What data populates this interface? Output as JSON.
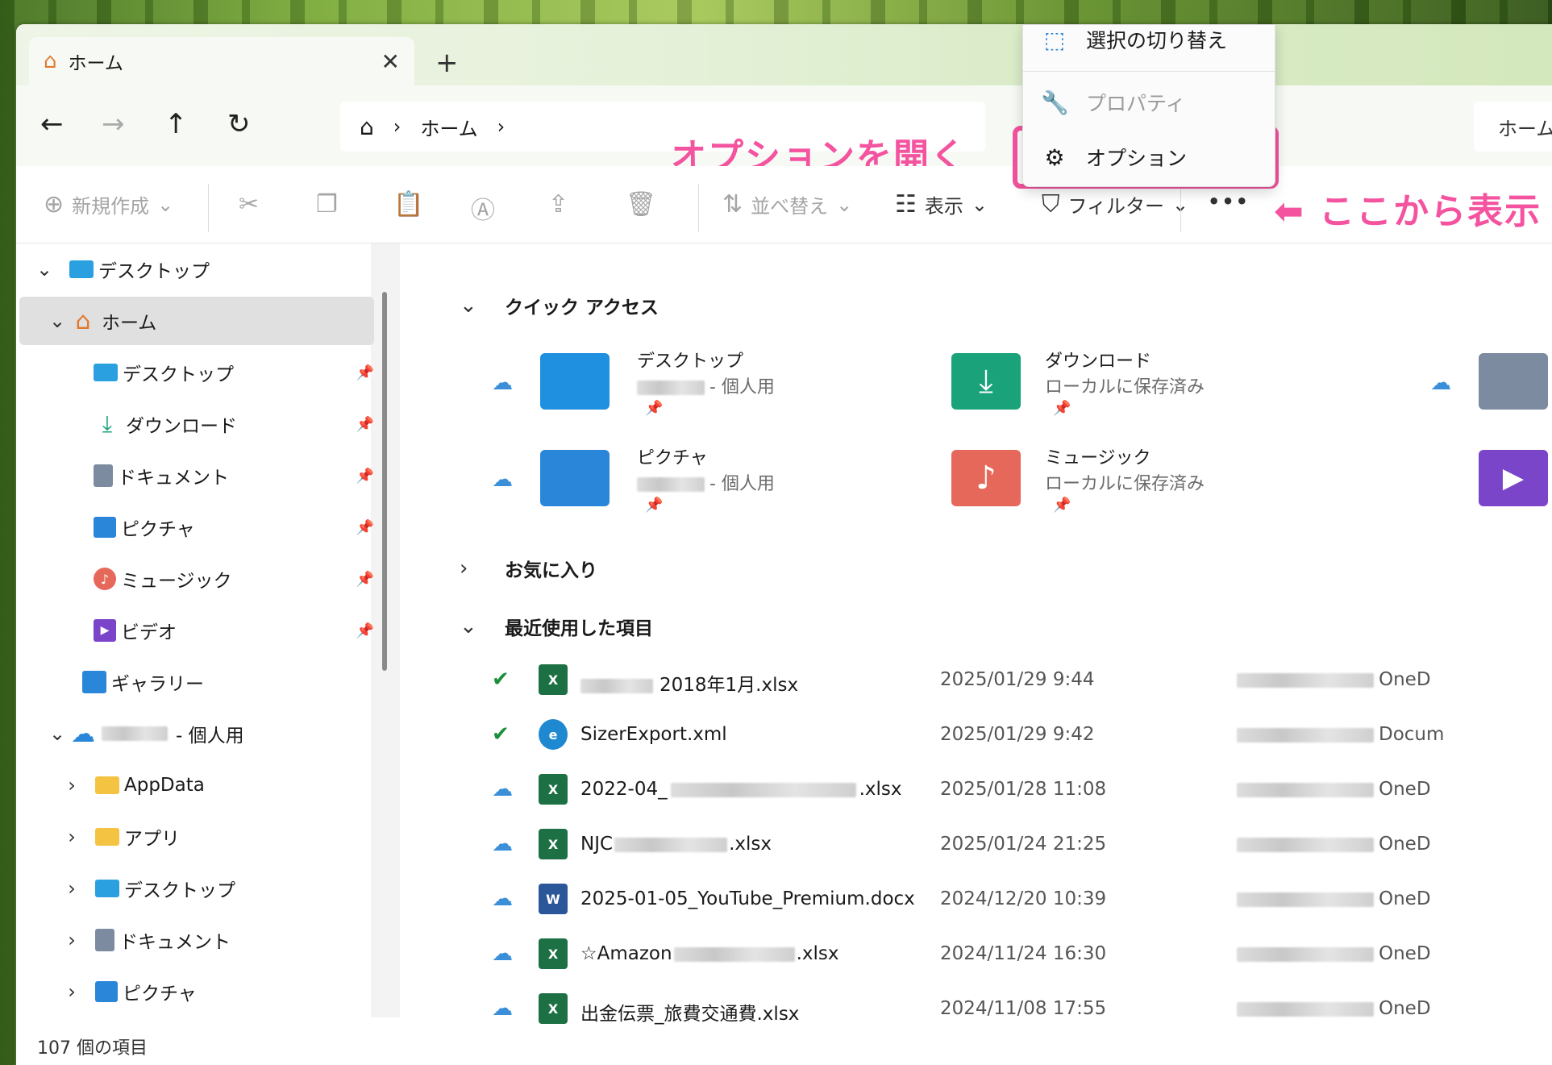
{
  "tab": {
    "title": "ホーム",
    "close": "✕",
    "new_tab": "+"
  },
  "nav": {
    "back": "←",
    "forward": "→",
    "up": "↑",
    "refresh": "↻"
  },
  "address": {
    "crumbs": [
      "ホーム"
    ],
    "sep": "›",
    "search_stub": "ホーム"
  },
  "annotations": {
    "open_options": "オプションを開く",
    "show_from_here": "⬅ ここから表示"
  },
  "menu": {
    "items": [
      {
        "label": "選択の切り替え",
        "icon": "select-toggle-icon"
      },
      {
        "label": "プロパティ",
        "icon": "wrench-icon"
      },
      {
        "label": "オプション",
        "icon": "gear-icon"
      }
    ]
  },
  "toolbar": {
    "new_label": "新規作成",
    "sort_label": "並べ替え",
    "view_label": "表示",
    "filter_label": "フィルター",
    "more_label": "•••",
    "chevron": "⌄"
  },
  "sidebar": {
    "items": [
      {
        "label": "デスクトップ",
        "icon": "desktop-icon",
        "pinned": false,
        "expanded": true
      },
      {
        "label": "ホーム",
        "icon": "home-icon",
        "pinned": false,
        "expanded": true,
        "selected": true
      },
      {
        "label": "デスクトップ",
        "icon": "desktop-icon",
        "pinned": true
      },
      {
        "label": "ダウンロード",
        "icon": "download-icon",
        "pinned": true
      },
      {
        "label": "ドキュメント",
        "icon": "document-icon",
        "pinned": true
      },
      {
        "label": "ピクチャ",
        "icon": "pictures-icon",
        "pinned": true
      },
      {
        "label": "ミュージック",
        "icon": "music-icon",
        "pinned": true
      },
      {
        "label": "ビデオ",
        "icon": "video-icon",
        "pinned": true
      },
      {
        "label": "ギャラリー",
        "icon": "gallery-icon",
        "pinned": false
      },
      {
        "label": "- 個人用",
        "icon": "onedrive-icon",
        "pinned": false,
        "expanded": true
      },
      {
        "label": "AppData",
        "icon": "folder-icon"
      },
      {
        "label": "アプリ",
        "icon": "folder-icon"
      },
      {
        "label": "デスクトップ",
        "icon": "desktop-icon"
      },
      {
        "label": "ドキュメント",
        "icon": "document-icon"
      },
      {
        "label": "ピクチャ",
        "icon": "pictures-icon"
      }
    ]
  },
  "sections": {
    "quick_access": "クイック アクセス",
    "favorites": "お気に入り",
    "recent": "最近使用した項目"
  },
  "quick_access": [
    {
      "name": "デスクトップ",
      "sub": "- 個人用",
      "icon": "desktop-folder-icon",
      "color": "#1f8fe0"
    },
    {
      "name": "ダウンロード",
      "sub": "ローカルに保存済み",
      "icon": "downloads-folder-icon",
      "color": "#1aa37a"
    },
    {
      "name": "ピクチャ",
      "sub": "- 個人用",
      "icon": "pictures-folder-icon",
      "color": "#2a86d8"
    },
    {
      "name": "ミュージック",
      "sub": "ローカルに保存済み",
      "icon": "music-folder-icon",
      "color": "#e5685a"
    }
  ],
  "recent": [
    {
      "name": "2018年1月.xlsx",
      "date": "2025/01/29 9:44",
      "loc": "OneD",
      "status": "synced",
      "type": "xlsx"
    },
    {
      "name": "SizerExport.xml",
      "date": "2025/01/29 9:42",
      "loc": "Docum",
      "status": "synced",
      "type": "edge"
    },
    {
      "name": "2022-04_",
      "name_tail": ".xlsx",
      "date": "2025/01/28 11:08",
      "loc": "OneD",
      "status": "cloud",
      "type": "xlsx"
    },
    {
      "name": "NJC",
      "name_tail": ".xlsx",
      "date": "2025/01/24 21:25",
      "loc": "OneD",
      "status": "cloud",
      "type": "xlsx"
    },
    {
      "name": "2025-01-05_YouTube_Premium.docx",
      "date": "2024/12/20 10:39",
      "loc": "OneD",
      "status": "cloud",
      "type": "docx"
    },
    {
      "name": "☆Amazon",
      "name_tail": ".xlsx",
      "date": "2024/11/24 16:30",
      "loc": "OneD",
      "status": "cloud",
      "type": "xlsx"
    },
    {
      "name": "出金伝票_旅費交通費.xlsx",
      "date": "2024/11/08 17:55",
      "loc": "OneD",
      "status": "cloud",
      "type": "xlsx"
    }
  ],
  "status": {
    "count": "107 個の項目"
  },
  "colors": {
    "accent_pink": "#f4539f",
    "excel_green": "#1d7044",
    "word_blue": "#2b579a",
    "onedrive_blue": "#3a8fd8"
  }
}
